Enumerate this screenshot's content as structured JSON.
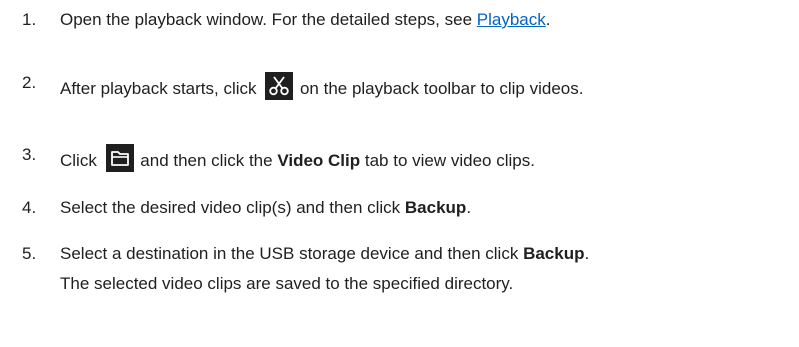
{
  "steps": [
    {
      "number": "1.",
      "before": "Open the playback window. For the detailed steps, see ",
      "link": "Playback",
      "after": "."
    },
    {
      "number": "2.",
      "before": "After playback starts, click ",
      "icon": "scissors-icon",
      "after": " on the playback toolbar to clip videos."
    },
    {
      "number": "3.",
      "before": "Click ",
      "icon": "folder-icon",
      "middle": " and then click the ",
      "bold": "Video Clip",
      "after": " tab to view video clips."
    },
    {
      "number": "4.",
      "before": "Select the desired video clip(s) and then click ",
      "bold": "Backup",
      "after": "."
    },
    {
      "number": "5.",
      "before": "Select a destination in the USB storage device and then click ",
      "bold": "Backup",
      "after": ".",
      "line2": "The selected video clips are saved to the specified directory."
    }
  ],
  "colors": {
    "text": "#1f1f1f",
    "link": "#0563c1",
    "icon_bg": "#1f1f1f"
  }
}
